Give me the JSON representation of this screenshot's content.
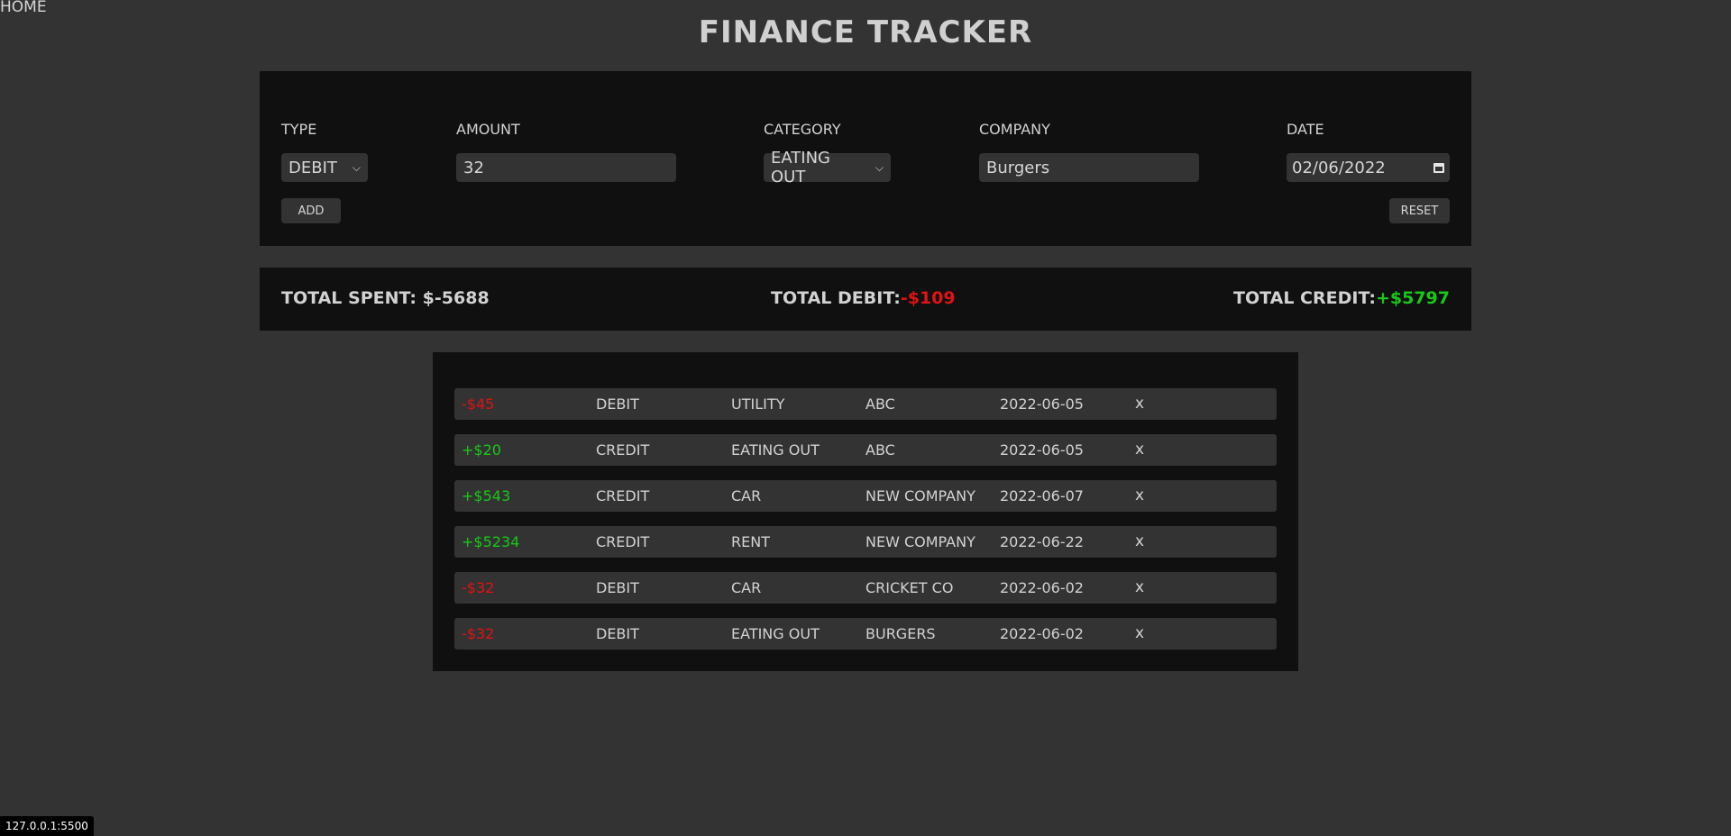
{
  "nav": {
    "home_label": "HOME"
  },
  "header": {
    "title": "FINANCE TRACKER"
  },
  "form": {
    "type_label": "TYPE",
    "type_value": "DEBIT",
    "amount_label": "AMOUNT",
    "amount_value": "32",
    "category_label": "CATEGORY",
    "category_value": "EATING OUT",
    "company_label": "COMPANY",
    "company_value": "Burgers",
    "date_label": "DATE",
    "date_value": "02/06/2022",
    "add_label": "ADD",
    "reset_label": "RESET"
  },
  "totals": {
    "spent_label": "TOTAL SPENT:",
    "spent_value": "$-5688",
    "debit_label": "TOTAL DEBIT:",
    "debit_value": "-$109",
    "credit_label": "TOTAL CREDIT:",
    "credit_value": "+$5797"
  },
  "transactions": [
    {
      "amount": "-$45",
      "sign": "neg",
      "type": "DEBIT",
      "category": "UTILITY",
      "company": "ABC",
      "date": "2022-06-05",
      "delete": "x"
    },
    {
      "amount": "+$20",
      "sign": "pos",
      "type": "CREDIT",
      "category": "EATING OUT",
      "company": "ABC",
      "date": "2022-06-05",
      "delete": "x"
    },
    {
      "amount": "+$543",
      "sign": "pos",
      "type": "CREDIT",
      "category": "CAR",
      "company": "NEW COMPANY",
      "date": "2022-06-07",
      "delete": "x"
    },
    {
      "amount": "+$5234",
      "sign": "pos",
      "type": "CREDIT",
      "category": "RENT",
      "company": "NEW COMPANY",
      "date": "2022-06-22",
      "delete": "x"
    },
    {
      "amount": "-$32",
      "sign": "neg",
      "type": "DEBIT",
      "category": "CAR",
      "company": "CRICKET CO",
      "date": "2022-06-02",
      "delete": "x"
    },
    {
      "amount": "-$32",
      "sign": "neg",
      "type": "DEBIT",
      "category": "EATING OUT",
      "company": "BURGERS",
      "date": "2022-06-02",
      "delete": "x"
    }
  ],
  "colors": {
    "background": "#333333",
    "panel": "#101010",
    "negative": "#e01212",
    "positive": "#18c818"
  },
  "status_bar": {
    "url": "127.0.0.1:5500"
  }
}
